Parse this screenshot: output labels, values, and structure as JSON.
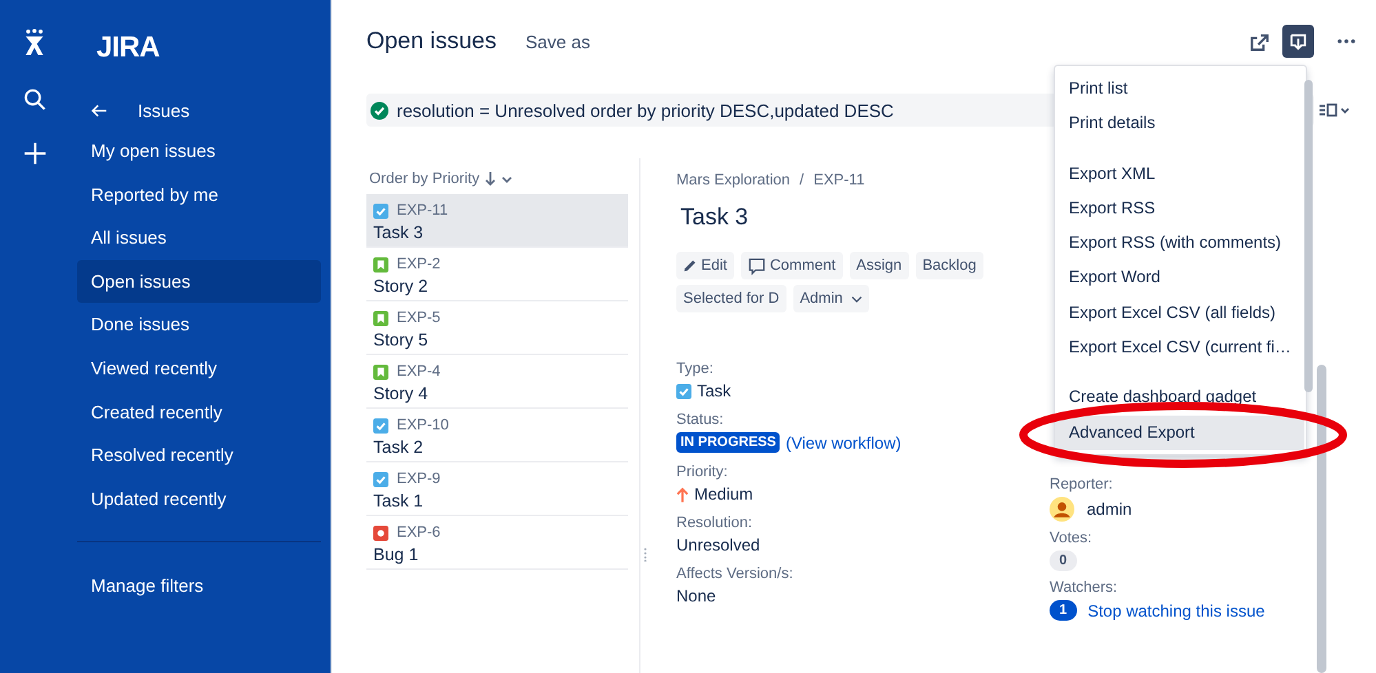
{
  "sidebar": {
    "logo": "JIRA",
    "back_title": "Issues",
    "items": [
      {
        "label": "My open issues",
        "selected": false
      },
      {
        "label": "Reported by me",
        "selected": false
      },
      {
        "label": "All issues",
        "selected": false
      },
      {
        "label": "Open issues",
        "selected": true
      },
      {
        "label": "Done issues",
        "selected": false
      },
      {
        "label": "Viewed recently",
        "selected": false
      },
      {
        "label": "Created recently",
        "selected": false
      },
      {
        "label": "Resolved recently",
        "selected": false
      },
      {
        "label": "Updated recently",
        "selected": false
      }
    ],
    "footer_item": "Manage filters"
  },
  "header": {
    "title": "Open issues",
    "save_as": "Save as"
  },
  "jql": "resolution = Unresolved order by priority DESC,updated DESC",
  "issue_list": {
    "sort_label": "Order by Priority",
    "items": [
      {
        "key": "EXP-11",
        "summary": "Task 3",
        "kind": "task",
        "selected": true
      },
      {
        "key": "EXP-2",
        "summary": "Story 2",
        "kind": "story",
        "selected": false
      },
      {
        "key": "EXP-5",
        "summary": "Story 5",
        "kind": "story",
        "selected": false
      },
      {
        "key": "EXP-4",
        "summary": "Story 4",
        "kind": "story",
        "selected": false
      },
      {
        "key": "EXP-10",
        "summary": "Task 2",
        "kind": "task",
        "selected": false
      },
      {
        "key": "EXP-9",
        "summary": "Task 1",
        "kind": "task",
        "selected": false
      },
      {
        "key": "EXP-6",
        "summary": "Bug 1",
        "kind": "bug",
        "selected": false
      }
    ]
  },
  "detail": {
    "breadcrumb": [
      "Mars Exploration",
      "EXP-11"
    ],
    "breadcrumb_separator": "/",
    "title": "Task 3",
    "actions": [
      {
        "label": "Edit",
        "kind": "edit"
      },
      {
        "label": "Comment",
        "kind": "comment"
      },
      {
        "label": "Assign",
        "kind": "plain"
      },
      {
        "label": "Backlog",
        "kind": "plain"
      },
      {
        "label": "Selected for D",
        "kind": "plain"
      },
      {
        "label": "Admin",
        "kind": "dropdown"
      }
    ],
    "fields": [
      {
        "label": "Type:",
        "kind": "type",
        "value": "Task"
      },
      {
        "label": "Status:",
        "kind": "status",
        "value": "IN PROGRESS",
        "link": "(View workflow)"
      },
      {
        "label": "Priority:",
        "kind": "priority",
        "value": "Medium"
      },
      {
        "label": "Resolution:",
        "kind": "text",
        "value": "Unresolved"
      },
      {
        "label": "Affects Version/s:",
        "kind": "text",
        "value": "None"
      }
    ],
    "people": [
      {
        "label": "Reporter:",
        "kind": "user",
        "value": "admin"
      },
      {
        "label": "Votes:",
        "kind": "count",
        "value": "0"
      },
      {
        "label": "Watchers:",
        "kind": "watch",
        "count": "1",
        "value": "Stop watching this issue"
      }
    ]
  },
  "export_menu": {
    "groups": [
      [
        {
          "label": "Print list",
          "highlighted": false
        },
        {
          "label": "Print details",
          "highlighted": false
        }
      ],
      [
        {
          "label": "Export XML",
          "highlighted": false
        },
        {
          "label": "Export RSS",
          "highlighted": false
        },
        {
          "label": "Export RSS (with comments)",
          "highlighted": false
        },
        {
          "label": "Export Word",
          "highlighted": false
        },
        {
          "label": "Export Excel CSV (all fields)",
          "highlighted": false
        },
        {
          "label": "Export Excel CSV (current fi…",
          "highlighted": false
        }
      ],
      [
        {
          "label": "Create dashboard gadget",
          "highlighted": false
        },
        {
          "label": "Advanced Export",
          "highlighted": true
        }
      ]
    ]
  }
}
